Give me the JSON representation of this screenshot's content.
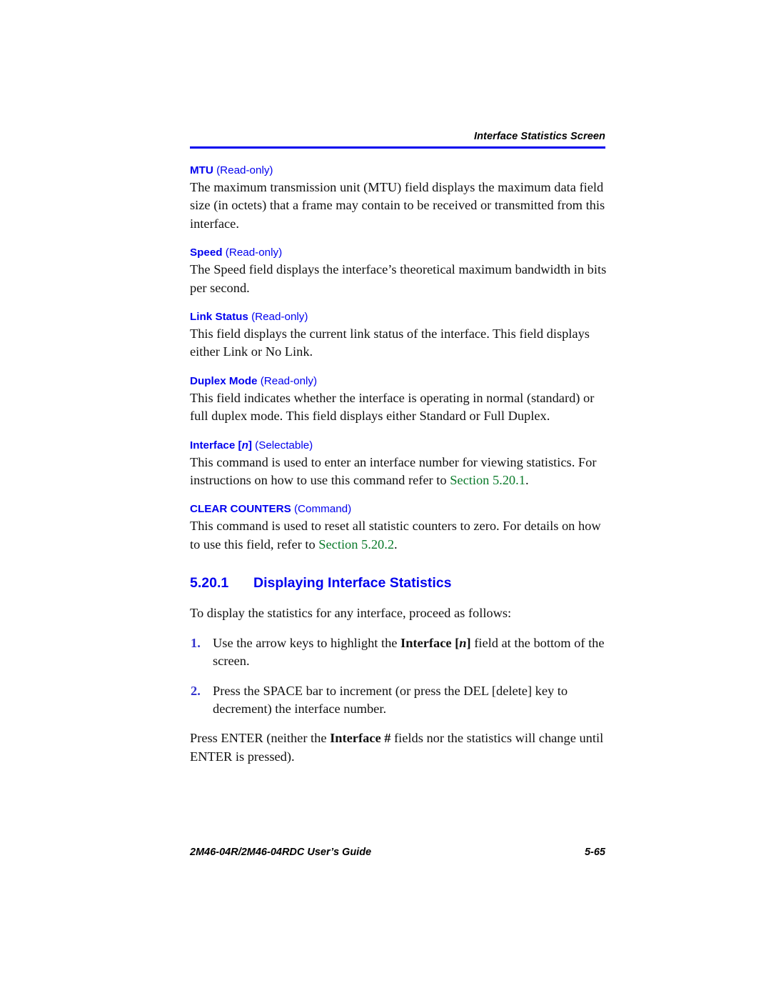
{
  "header": {
    "running_title": "Interface Statistics Screen",
    "rule_color": "#0000ee"
  },
  "fields": [
    {
      "term": "MTU",
      "qualifier": "(Read-only)",
      "body_html": "The maximum transmission unit (MTU) field displays the maximum data field size (in octets) that a frame may contain to be received or transmitted from this interface."
    },
    {
      "term": "Speed",
      "qualifier": "(Read-only)",
      "body_html": "The Speed field displays the interface&rsquo;s theoretical maximum bandwidth in bits per second."
    },
    {
      "term": "Link Status",
      "qualifier": "(Read-only)",
      "body_html": "This field displays the current link status of the interface. This field displays either Link or No Link."
    },
    {
      "term": "Duplex Mode",
      "qualifier": "(Read-only)",
      "body_html": "This field indicates whether the interface is operating in normal (standard) or full duplex mode. This field displays either Standard or Full Duplex."
    },
    {
      "term_html": "Interface [<i>n</i>]",
      "term": "Interface [n]",
      "qualifier": "(Selectable)",
      "body_html": "This command is used to enter an interface number for viewing statistics. For instructions on how to use this command refer to <span class=\"xref\">Section 5.20.1</span>."
    },
    {
      "term": "CLEAR COUNTERS",
      "qualifier": "(Command)",
      "body_html": "This command is used to reset all statistic counters to zero. For details on how to use this field, refer to <span class=\"xref\">Section 5.20.2</span>."
    }
  ],
  "section": {
    "number": "5.20.1",
    "title": "Displaying Interface Statistics",
    "lead_in": "To display the statistics for any interface, proceed as follows:",
    "steps": [
      {
        "marker": "1.",
        "text_html": "Use the arrow keys to highlight the <b>Interface [<i>n</i>]</b> field at the bottom of the screen."
      },
      {
        "marker": "2.",
        "text_html": "Press the SPACE bar to increment (or press the DEL [delete] key to decrement) the interface number."
      }
    ],
    "closing_html": "Press ENTER (neither the <b>Interface #</b> fields nor the statistics will change until ENTER is pressed)."
  },
  "footer": {
    "guide_title": "2M46-04R/2M46-04RDC User’s Guide",
    "page_number": "5-65"
  }
}
